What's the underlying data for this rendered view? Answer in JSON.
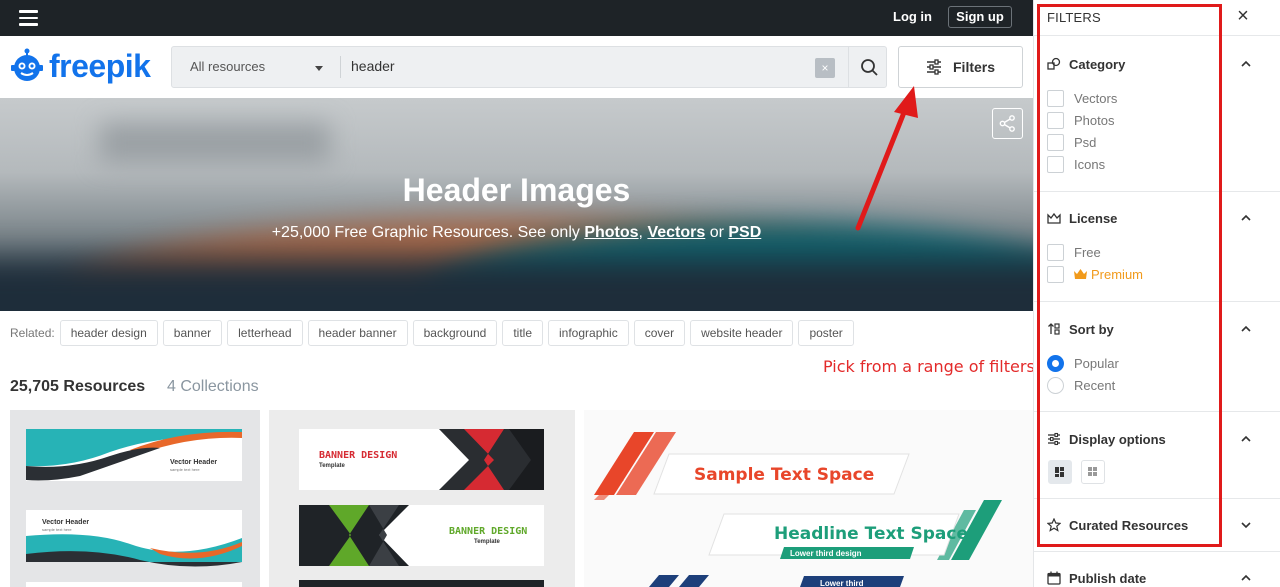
{
  "topbar": {
    "login": "Log in",
    "signup": "Sign up"
  },
  "logo": {
    "text": "freepik"
  },
  "search": {
    "resource_type": "All resources",
    "query": "header",
    "clear": "×",
    "filters_label": "Filters"
  },
  "hero": {
    "title": "Header Images",
    "sub_prefix": "+25,000 Free Graphic Resources. See only ",
    "link_photos": "Photos",
    "comma": ", ",
    "link_vectors": "Vectors",
    "or": " or ",
    "link_psd": "PSD"
  },
  "related": {
    "label": "Related:",
    "tags": [
      "header design",
      "banner",
      "letterhead",
      "header banner",
      "background",
      "title",
      "infographic",
      "cover",
      "website header",
      "poster"
    ]
  },
  "annotation": "Pick from a range of filters",
  "results": {
    "count": "25,705 Resources",
    "collections": "4 Collections"
  },
  "thumbs": {
    "t1": {
      "line1": "Vector Header",
      "line2": "sample text here"
    },
    "t2": {
      "a_title": "BANNER DESIGN",
      "a_sub": "Template",
      "b_title": "BANNER DESIGN",
      "b_sub": "Template"
    },
    "t3": {
      "sample": "Sample Text Space",
      "headline": "Headline Text Space",
      "lower": "Lower third design",
      "lower2": "Lower third"
    }
  },
  "filters": {
    "title": "FILTERS",
    "close": "×",
    "category": {
      "label": "Category",
      "options": [
        "Vectors",
        "Photos",
        "Psd",
        "Icons"
      ]
    },
    "license": {
      "label": "License",
      "options": [
        "Free",
        "Premium"
      ]
    },
    "sort": {
      "label": "Sort by",
      "options": [
        "Popular",
        "Recent"
      ],
      "selected": "Popular"
    },
    "display": {
      "label": "Display options"
    },
    "curated": {
      "label": "Curated Resources"
    },
    "publish": {
      "label": "Publish date"
    }
  },
  "colors": {
    "brand": "#1273eb",
    "annotation": "#e01a1a",
    "premium": "#f19a1b"
  }
}
